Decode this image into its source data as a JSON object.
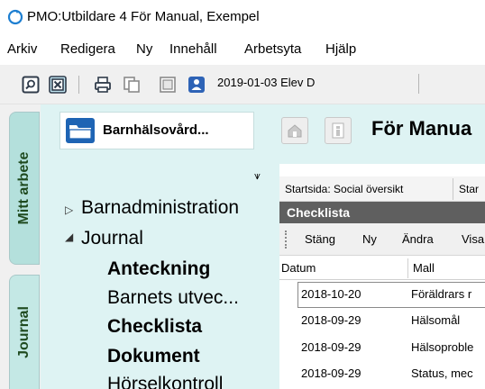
{
  "window": {
    "title": "PMO:Utbildare 4  För Manual, Exempel",
    "app_icon": "refresh-circle-icon",
    "accent": "#1e7fd1"
  },
  "menu": [
    {
      "label": "Arkiv"
    },
    {
      "label": "Redigera"
    },
    {
      "label": "Ny"
    },
    {
      "label": "Innehåll"
    },
    {
      "label": "Arbetsyta"
    },
    {
      "label": "Hjälp"
    }
  ],
  "toolbar": {
    "buttons": [
      "search-window-icon",
      "close-window-icon",
      "print-icon",
      "copy-icon",
      "document-icon",
      "person-icon"
    ],
    "context": "2019-01-03  Elev D"
  },
  "side_tabs": [
    {
      "label": "Mitt arbete",
      "color": "#b4e0dc"
    },
    {
      "label": "Journal",
      "color": "#c4e8e5"
    }
  ],
  "left_panel": {
    "patient": "Barnhälsovård...",
    "pin_icon": "pin-icon",
    "tree": [
      {
        "label": "Barnadministration",
        "expander": "▷"
      },
      {
        "label": "Journal",
        "expander": "◢"
      },
      {
        "label": "Anteckning",
        "bold": true
      },
      {
        "label": "Barnets utvec...",
        "bold": false
      },
      {
        "label": "Checklista",
        "bold": true
      },
      {
        "label": "Dokument",
        "bold": true
      },
      {
        "label": "Hörselkontroll",
        "bold": false
      }
    ]
  },
  "main": {
    "title": "För Manua",
    "home_icon": "home-icon",
    "info_icon": "info-icon",
    "breadcrumb": {
      "start": "Startsida: Social översikt",
      "next": "Star"
    },
    "section_title": "Checklista",
    "actions": [
      {
        "label": "Stäng"
      },
      {
        "label": "Ny"
      },
      {
        "label": "Ändra"
      },
      {
        "label": "Visa"
      }
    ],
    "columns": [
      "Datum",
      "Mall"
    ],
    "rows": [
      {
        "date": "2018-10-20",
        "template": "Föräldrars r"
      },
      {
        "date": "2018-09-29",
        "template": "Hälsomål"
      },
      {
        "date": "2018-09-29",
        "template": "Hälsoproble"
      },
      {
        "date": "2018-09-29",
        "template": "Status, mec"
      }
    ]
  }
}
